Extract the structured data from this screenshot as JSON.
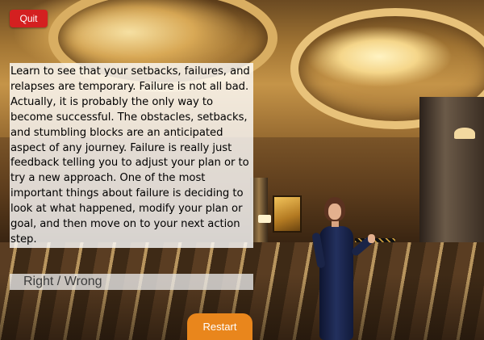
{
  "toolbar": {
    "quit_label": "Quit"
  },
  "content": {
    "passage": "Learn to see that your setbacks, failures, and relapses are temporary. Failure is not all bad. Actually, it is probably the only way to become successful. The obstacles, setbacks, and stumbling blocks are an anticipated aspect of any journey. Failure is really just feedback telling you to adjust your plan or to try a new approach. One of the most important things about failure is deciding to look at what happened, modify your plan or goal, and then move on to your next action step."
  },
  "answer": {
    "label": "Right / Wrong"
  },
  "footer": {
    "restart_label": "Restart"
  },
  "colors": {
    "quit_button": "#d42020",
    "restart_button": "#e9861c"
  }
}
